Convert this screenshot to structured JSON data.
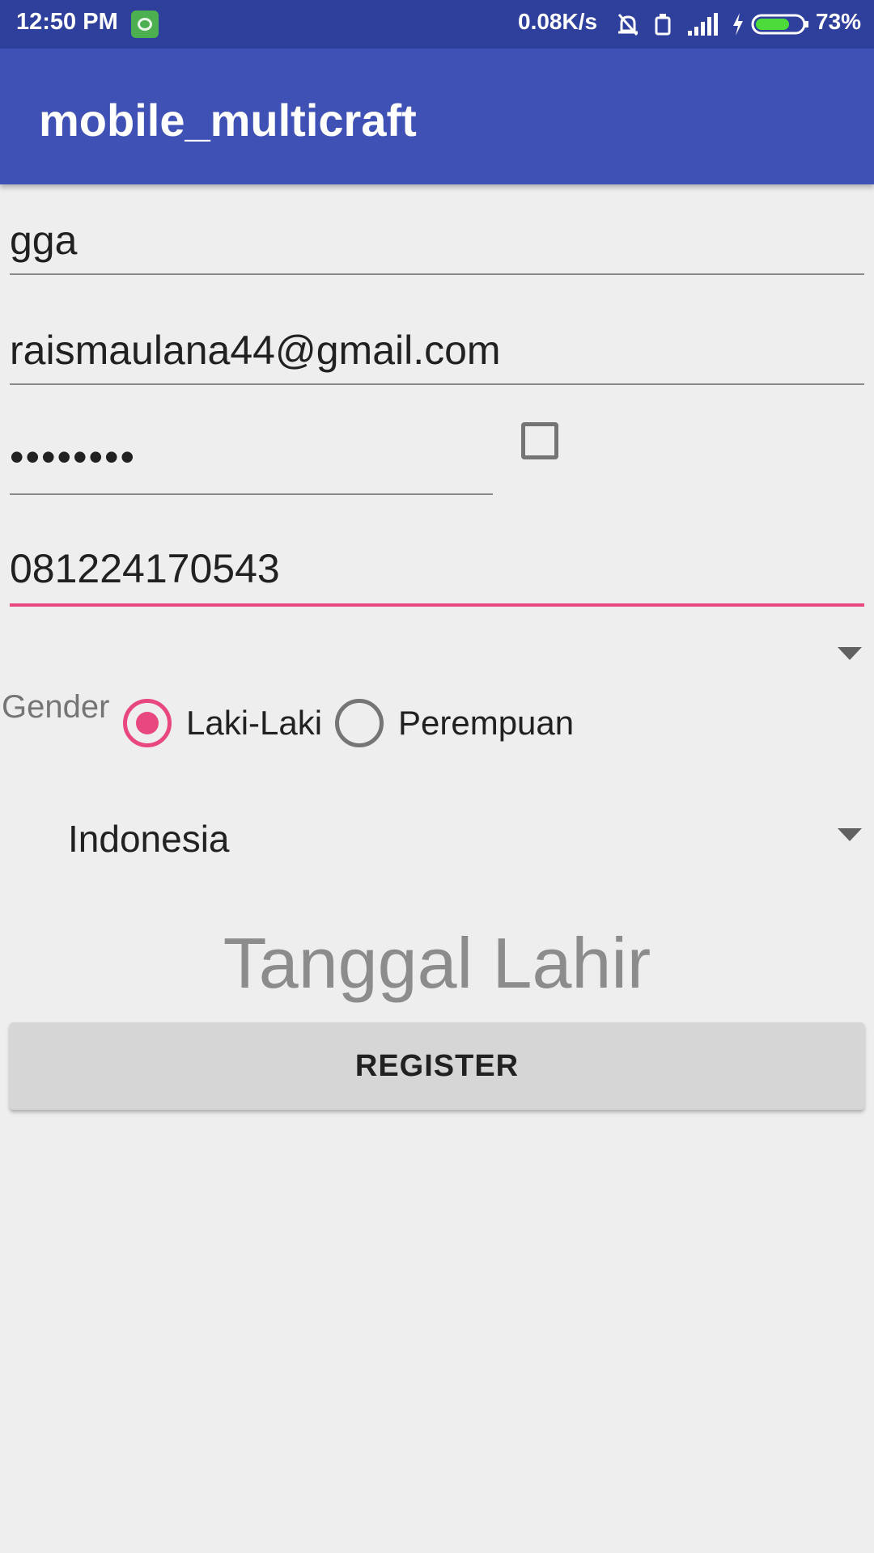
{
  "status_bar": {
    "time": "12:50 PM",
    "net_speed": "0.08K/s",
    "battery_percent": "73%",
    "battery_level": 0.73,
    "icons": [
      "app-notification-icon",
      "silent-bell-icon",
      "vibrate-icon",
      "signal-icon",
      "charging-icon",
      "battery-icon"
    ]
  },
  "app_bar": {
    "title": "mobile_multicraft"
  },
  "form": {
    "username_value": "gga",
    "email_value": "raismaulana44@gmail.com",
    "password_value": "••••••••",
    "show_password_checked": false,
    "phone_value": "081224170543",
    "gender_label": "Gender",
    "gender_options": [
      "Laki-Laki",
      "Perempuan"
    ],
    "gender_selected": "Laki-Laki",
    "country_selected": "Indonesia",
    "dob_label": "Tanggal Lahir",
    "register_label": "REGISTER"
  },
  "colors": {
    "status_bar": "#2e3f9c",
    "app_bar": "#3f51b5",
    "accent": "#e84780",
    "background": "#eeeeee"
  }
}
